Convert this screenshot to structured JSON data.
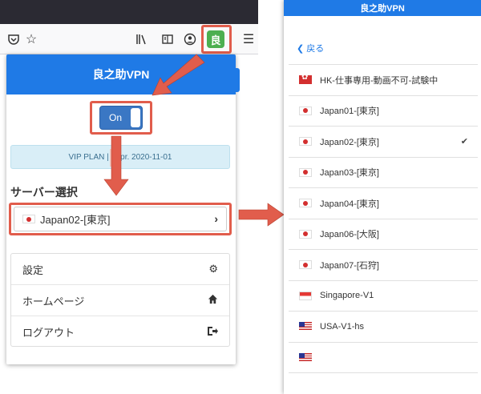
{
  "browser": {
    "toolbar_icons": [
      "pocket-icon",
      "bookmark-star-icon",
      "library-icon",
      "reader-view-icon",
      "account-icon",
      "menu-icon"
    ],
    "extension_icon_text": "良"
  },
  "popup": {
    "title": "良之助VPN",
    "toggle_label": "On",
    "plan_text": "VIP PLAN | Expr. 2020-11-01",
    "section_title": "サーバー選択",
    "selected_server": "Japan02-[東京]",
    "menu": [
      {
        "label": "設定",
        "icon": "gear-icon"
      },
      {
        "label": "ホームページ",
        "icon": "home-icon"
      },
      {
        "label": "ログアウト",
        "icon": "logout-icon"
      }
    ]
  },
  "server_panel": {
    "title": "良之助VPN",
    "back_label": "戻る",
    "servers": [
      {
        "label": "HK-仕事専用-動画不可-試験中",
        "flag": "hk",
        "selected": false
      },
      {
        "label": "Japan01-[東京]",
        "flag": "jp",
        "selected": false
      },
      {
        "label": "Japan02-[東京]",
        "flag": "jp",
        "selected": true
      },
      {
        "label": "Japan03-[東京]",
        "flag": "jp",
        "selected": false
      },
      {
        "label": "Japan04-[東京]",
        "flag": "jp",
        "selected": false
      },
      {
        "label": "Japan06-[大阪]",
        "flag": "jp",
        "selected": false
      },
      {
        "label": "Japan07-[石狩]",
        "flag": "jp",
        "selected": false
      },
      {
        "label": "Singapore-V1",
        "flag": "sg",
        "selected": false
      },
      {
        "label": "USA-V1-hs",
        "flag": "us",
        "selected": false
      },
      {
        "label": "",
        "flag": "us",
        "selected": false
      }
    ]
  },
  "colors": {
    "brand_blue": "#1f7ae6",
    "highlight_red": "#e15d4c",
    "plan_bg": "#d9eef7"
  }
}
